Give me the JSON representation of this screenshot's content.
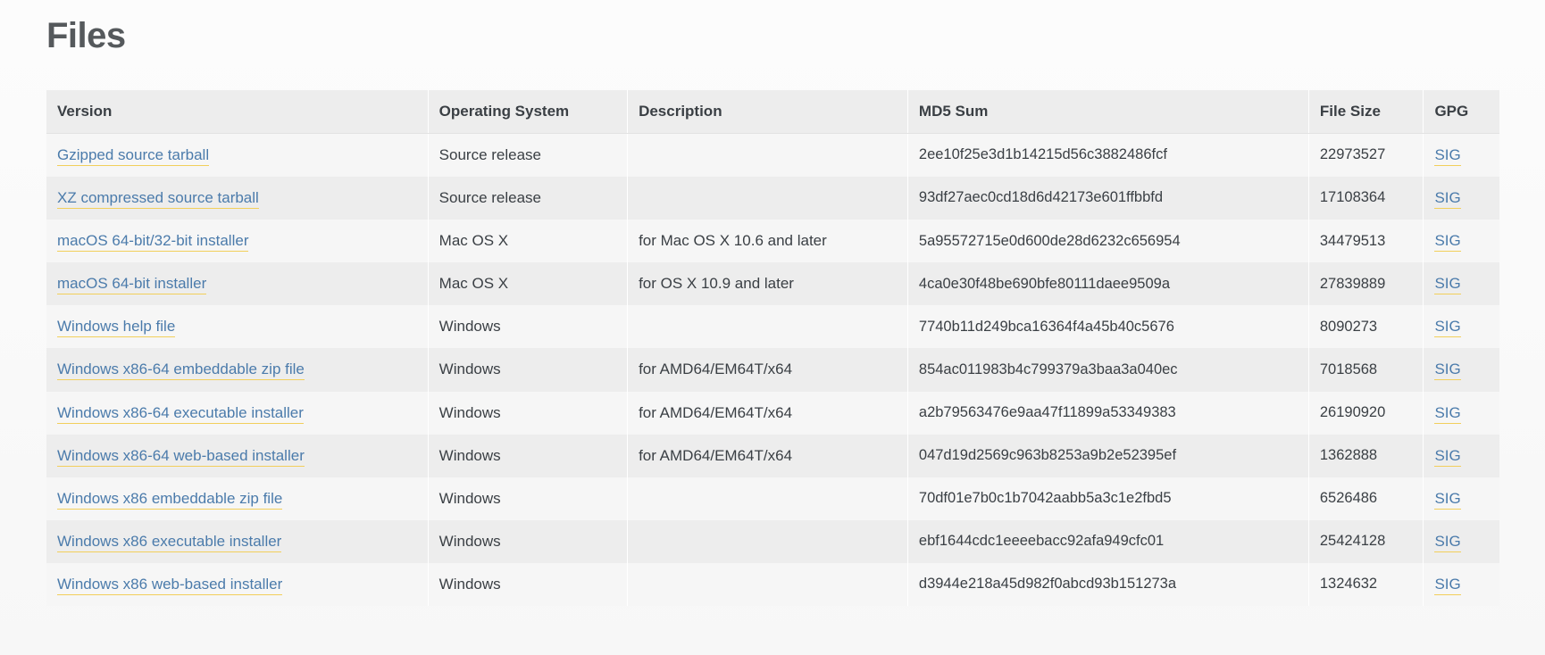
{
  "page": {
    "title": "Files"
  },
  "table": {
    "columns": [
      {
        "key": "version",
        "label": "Version"
      },
      {
        "key": "os",
        "label": "Operating System"
      },
      {
        "key": "description",
        "label": "Description"
      },
      {
        "key": "md5",
        "label": "MD5 Sum"
      },
      {
        "key": "size",
        "label": "File Size"
      },
      {
        "key": "gpg",
        "label": "GPG"
      }
    ],
    "rows": [
      {
        "version": "Gzipped source tarball",
        "os": "Source release",
        "description": "",
        "md5": "2ee10f25e3d1b14215d56c3882486fcf",
        "size": "22973527",
        "gpg": "SIG"
      },
      {
        "version": "XZ compressed source tarball",
        "os": "Source release",
        "description": "",
        "md5": "93df27aec0cd18d6d42173e601ffbbfd",
        "size": "17108364",
        "gpg": "SIG"
      },
      {
        "version": "macOS 64-bit/32-bit installer",
        "os": "Mac OS X",
        "description": "for Mac OS X 10.6 and later",
        "md5": "5a95572715e0d600de28d6232c656954",
        "size": "34479513",
        "gpg": "SIG"
      },
      {
        "version": "macOS 64-bit installer",
        "os": "Mac OS X",
        "description": "for OS X 10.9 and later",
        "md5": "4ca0e30f48be690bfe80111daee9509a",
        "size": "27839889",
        "gpg": "SIG"
      },
      {
        "version": "Windows help file",
        "os": "Windows",
        "description": "",
        "md5": "7740b11d249bca16364f4a45b40c5676",
        "size": "8090273",
        "gpg": "SIG"
      },
      {
        "version": "Windows x86-64 embeddable zip file",
        "os": "Windows",
        "description": "for AMD64/EM64T/x64",
        "md5": "854ac011983b4c799379a3baa3a040ec",
        "size": "7018568",
        "gpg": "SIG"
      },
      {
        "version": "Windows x86-64 executable installer",
        "os": "Windows",
        "description": "for AMD64/EM64T/x64",
        "md5": "a2b79563476e9aa47f11899a53349383",
        "size": "26190920",
        "gpg": "SIG"
      },
      {
        "version": "Windows x86-64 web-based installer",
        "os": "Windows",
        "description": "for AMD64/EM64T/x64",
        "md5": "047d19d2569c963b8253a9b2e52395ef",
        "size": "1362888",
        "gpg": "SIG"
      },
      {
        "version": "Windows x86 embeddable zip file",
        "os": "Windows",
        "description": "",
        "md5": "70df01e7b0c1b7042aabb5a3c1e2fbd5",
        "size": "6526486",
        "gpg": "SIG"
      },
      {
        "version": "Windows x86 executable installer",
        "os": "Windows",
        "description": "",
        "md5": "ebf1644cdc1eeeebacc92afa949cfc01",
        "size": "25424128",
        "gpg": "SIG"
      },
      {
        "version": "Windows x86 web-based installer",
        "os": "Windows",
        "description": "",
        "md5": "d3944e218a45d982f0abcd93b151273a",
        "size": "1324632",
        "gpg": "SIG"
      }
    ]
  },
  "colors": {
    "link": "#4b7bab",
    "link_underline": "#f2cf5b",
    "header_bg": "#ededed",
    "row_odd_bg": "#f6f6f6",
    "row_even_bg": "#ededed",
    "title": "#55595c",
    "text": "#3a3f44"
  }
}
